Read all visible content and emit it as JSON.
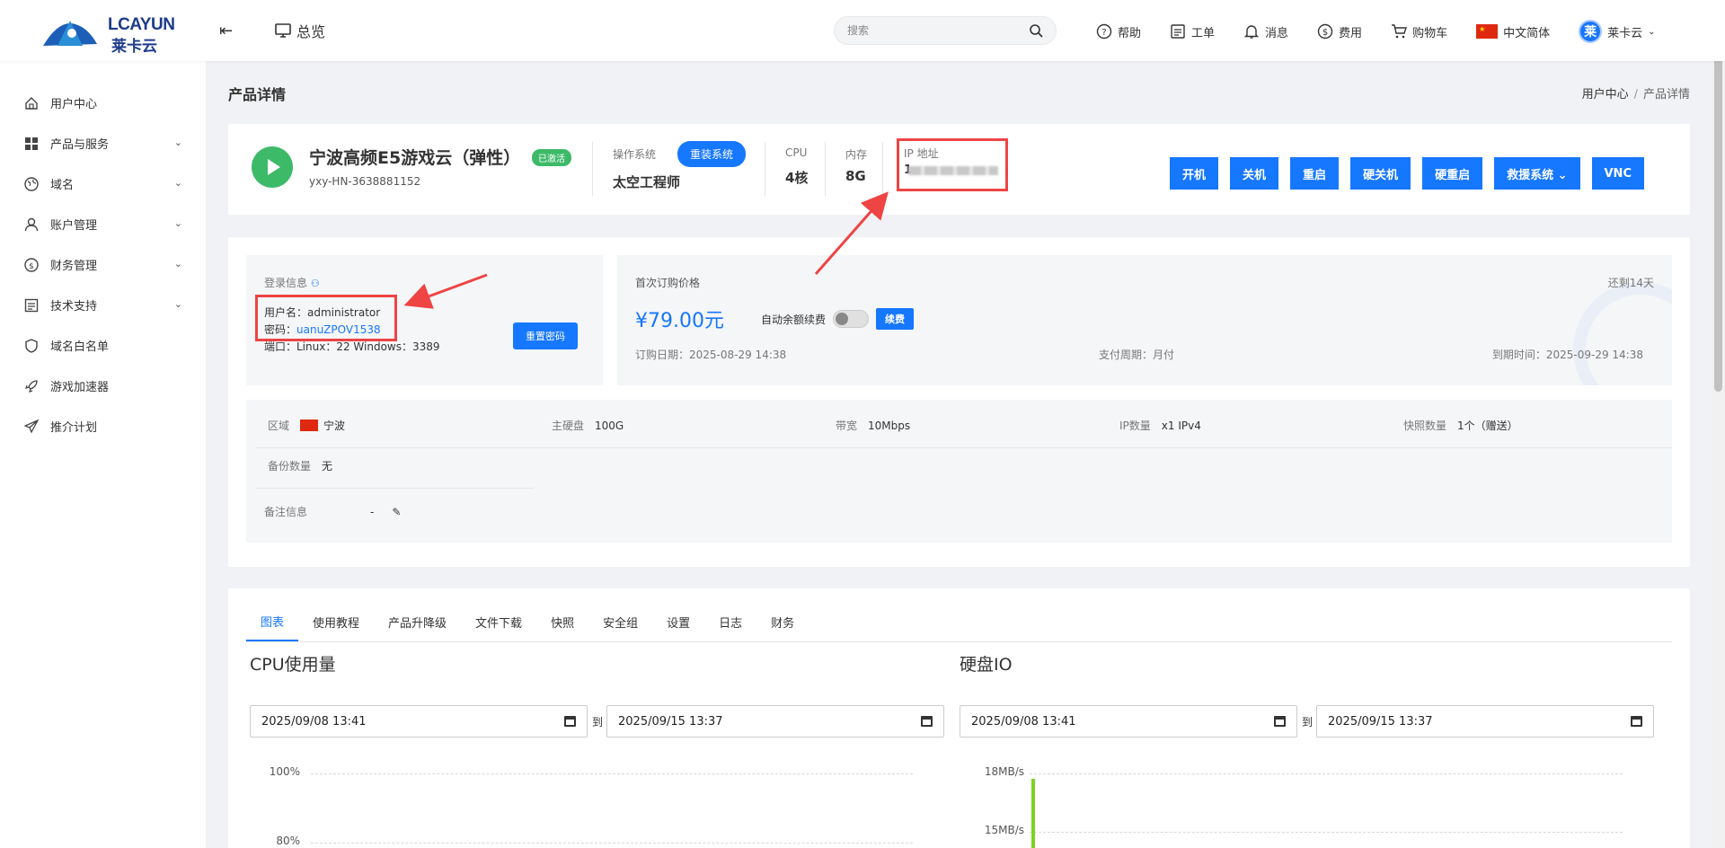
{
  "header": {
    "logo_text": "LCAYUN",
    "logo_cn": "莱卡云",
    "overview": "总览",
    "search_placeholder": "搜索",
    "nav": [
      {
        "label": "帮助",
        "icon": "help-circle-icon"
      },
      {
        "label": "工单",
        "icon": "ticket-icon"
      },
      {
        "label": "消息",
        "icon": "bell-icon"
      },
      {
        "label": "费用",
        "icon": "dollar-circle-icon"
      },
      {
        "label": "购物车",
        "icon": "cart-icon"
      }
    ],
    "language": "中文简体",
    "avatar_char": "莱",
    "user_name": "莱卡云"
  },
  "sidebar": {
    "items": [
      {
        "label": "用户中心",
        "icon": "home-icon"
      },
      {
        "label": "产品与服务",
        "icon": "grid-icon"
      },
      {
        "label": "域名",
        "icon": "globe-icon"
      },
      {
        "label": "账户管理",
        "icon": "user-icon"
      },
      {
        "label": "财务管理",
        "icon": "dollar-circle-icon"
      },
      {
        "label": "技术支持",
        "icon": "document-icon"
      },
      {
        "label": "域名白名单",
        "icon": "shield-icon"
      },
      {
        "label": "游戏加速器",
        "icon": "rocket-icon"
      },
      {
        "label": "推介计划",
        "icon": "send-icon"
      }
    ]
  },
  "page": {
    "title": "产品详情",
    "breadcrumb": [
      "用户中心",
      "/",
      "产品详情"
    ]
  },
  "product": {
    "name": "宁波高频E5游戏云（弹性）",
    "status": "已激活",
    "id": "yxy-HN-3638881152",
    "os_label": "操作系统",
    "reinstall": "重装系统",
    "os_value": "太空工程师",
    "cpu_label": "CPU",
    "cpu_value": "4核",
    "mem_label": "内存",
    "mem_value": "8G",
    "ip_label": "IP 地址",
    "ip_value": "1",
    "actions": [
      "开机",
      "关机",
      "重启",
      "硬关机",
      "硬重启",
      "救援系统 ⌄",
      "VNC"
    ]
  },
  "login": {
    "title": "登录信息",
    "username_label": "用户名：",
    "username": "administrator",
    "password_label": "密码：",
    "password": "uanuZPOV1538",
    "port_line": "端口：Linux：22 Windows：3389",
    "reset": "重置密码"
  },
  "billing": {
    "first_price_label": "首次订购价格",
    "remain": "还剩14天",
    "price": "¥79.00元",
    "auto_renew": "自动余额续费",
    "renew": "续费",
    "order_date": "订购日期：2025-08-29 14:38",
    "period": "支付周期：月付",
    "expire": "到期时间：2025-09-29 14:38"
  },
  "specs": {
    "region_label": "区域",
    "region": "宁波",
    "disk_label": "主硬盘",
    "disk": "100G",
    "bw_label": "带宽",
    "bw": "10Mbps",
    "ip_count_label": "IP数量",
    "ip_count": "x1 IPv4",
    "snap_label": "快照数量",
    "snap": "1个（赠送）",
    "backup_label": "备份数量",
    "backup": "无",
    "note_label": "备注信息",
    "note": "-"
  },
  "tabs": [
    "图表",
    "使用教程",
    "产品升降级",
    "文件下载",
    "快照",
    "安全组",
    "设置",
    "日志",
    "财务"
  ],
  "charts": {
    "cpu_title": "CPU使用量",
    "disk_title": "硬盘IO",
    "date_from": "2025/09/08  13:41",
    "date_to": "2025/09/15  13:37",
    "to": "到",
    "cpu_ticks": [
      "100%",
      "80%"
    ],
    "disk_ticks": [
      "18MB/s",
      "15MB/s"
    ]
  },
  "colors": {
    "primary": "#1677ff",
    "success": "#3dba68",
    "annotation": "#ee4444"
  }
}
